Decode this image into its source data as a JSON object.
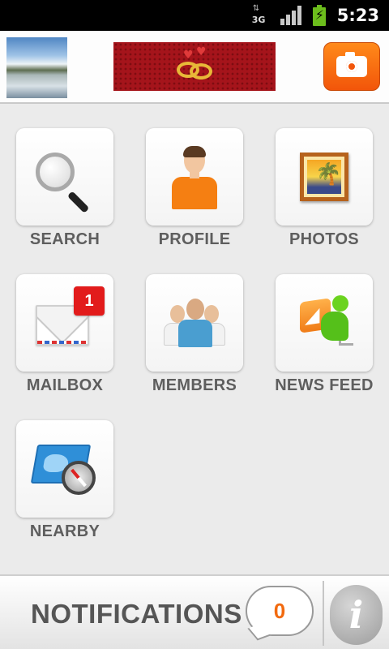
{
  "status_bar": {
    "network": "3G",
    "time": "5:23"
  },
  "header": {
    "avatar_icon": "landscape-thumbnail",
    "banner_icon": "wedding-rings-hearts",
    "camera_icon": "camera-icon",
    "accent_color": "#f2550a"
  },
  "menu": [
    {
      "label": "SEARCH",
      "icon": "magnifier-icon"
    },
    {
      "label": "PROFILE",
      "icon": "person-icon"
    },
    {
      "label": "PHOTOS",
      "icon": "framed-photo-icon"
    },
    {
      "label": "MAILBOX",
      "icon": "envelope-icon",
      "badge": "1"
    },
    {
      "label": "MEMBERS",
      "icon": "people-group-icon"
    },
    {
      "label": "NEWS FEED",
      "icon": "rss-reader-icon"
    },
    {
      "label": "NEARBY",
      "icon": "map-compass-icon"
    }
  ],
  "bottom_bar": {
    "notifications_label": "NOTIFICATIONS",
    "notifications_count": "0",
    "info_label": "i"
  }
}
